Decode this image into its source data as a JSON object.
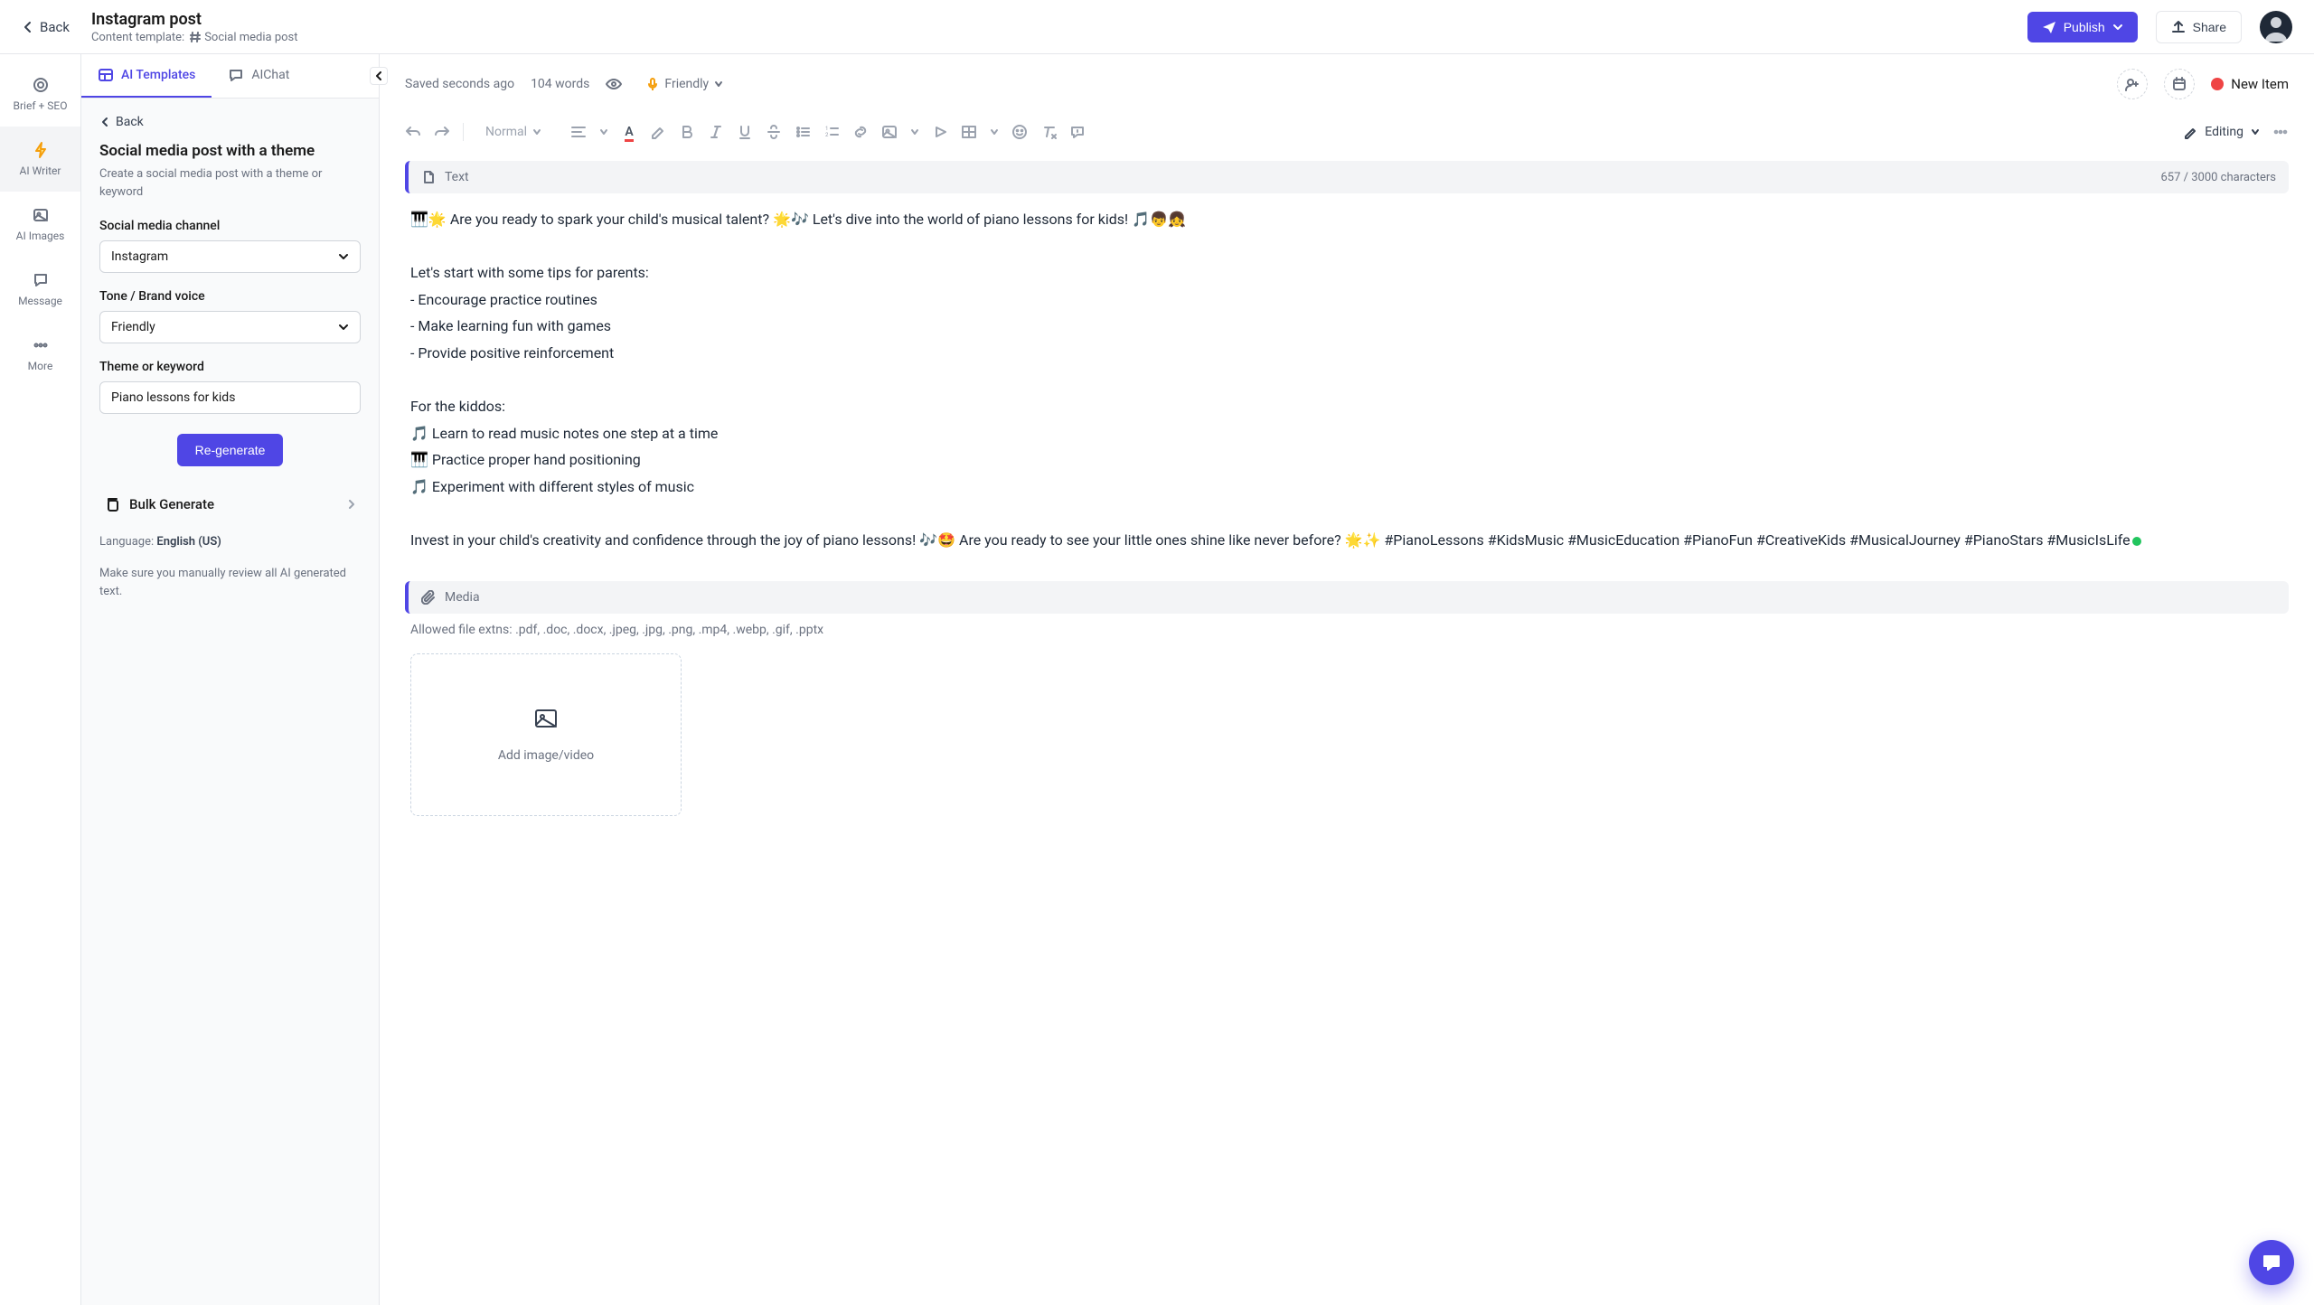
{
  "topbar": {
    "back": "Back",
    "title": "Instagram post",
    "subtitle_label": "Content template:",
    "subtitle_value": "Social media post",
    "publish": "Publish",
    "share": "Share"
  },
  "rail": {
    "items": [
      {
        "label": "Brief + SEO"
      },
      {
        "label": "AI Writer"
      },
      {
        "label": "AI Images"
      },
      {
        "label": "Message"
      },
      {
        "label": "More"
      }
    ]
  },
  "sidebar": {
    "tabs": {
      "templates": "AI Templates",
      "chat": "AIChat"
    },
    "back": "Back",
    "heading": "Social media post with a theme",
    "desc": "Create a social media post with a theme or keyword",
    "channel_label": "Social media channel",
    "channel_value": "Instagram",
    "tone_label": "Tone / Brand voice",
    "tone_value": "Friendly",
    "theme_label": "Theme or keyword",
    "theme_value": "Piano lessons for kids",
    "regen": "Re-generate",
    "bulk": "Bulk Generate",
    "lang_label": "Language:",
    "lang_value": "English (US)",
    "disclaimer": "Make sure you manually review all AI generated text."
  },
  "editor": {
    "saved": "Saved seconds ago",
    "words": "104 words",
    "voice": "Friendly",
    "status": "New Item",
    "style_sel": "Normal",
    "editing": "Editing",
    "text_block_label": "Text",
    "char_count": "657 / 3000 characters",
    "body": "🎹🌟 Are you ready to spark your child's musical talent? 🌟🎶 Let's dive into the world of piano lessons for kids! 🎵👦👧\n\nLet's start with some tips for parents:\n- Encourage practice routines\n- Make learning fun with games\n- Provide positive reinforcement\n\nFor the kiddos:\n🎵 Learn to read music notes one step at a time\n🎹 Practice proper hand positioning\n🎵 Experiment with different styles of music\n\nInvest in your child's creativity and confidence through the joy of piano lessons! 🎶🤩 Are you ready to see your little ones shine like never before? 🌟✨ #PianoLessons #KidsMusic #MusicEducation #PianoFun #CreativeKids #MusicalJourney #PianoStars #MusicIsLife",
    "media_block_label": "Media",
    "allowed": "Allowed file extns: .pdf, .doc, .docx, .jpeg, .jpg, .png, .mp4, .webp, .gif, .pptx",
    "dropzone": "Add image/video"
  }
}
